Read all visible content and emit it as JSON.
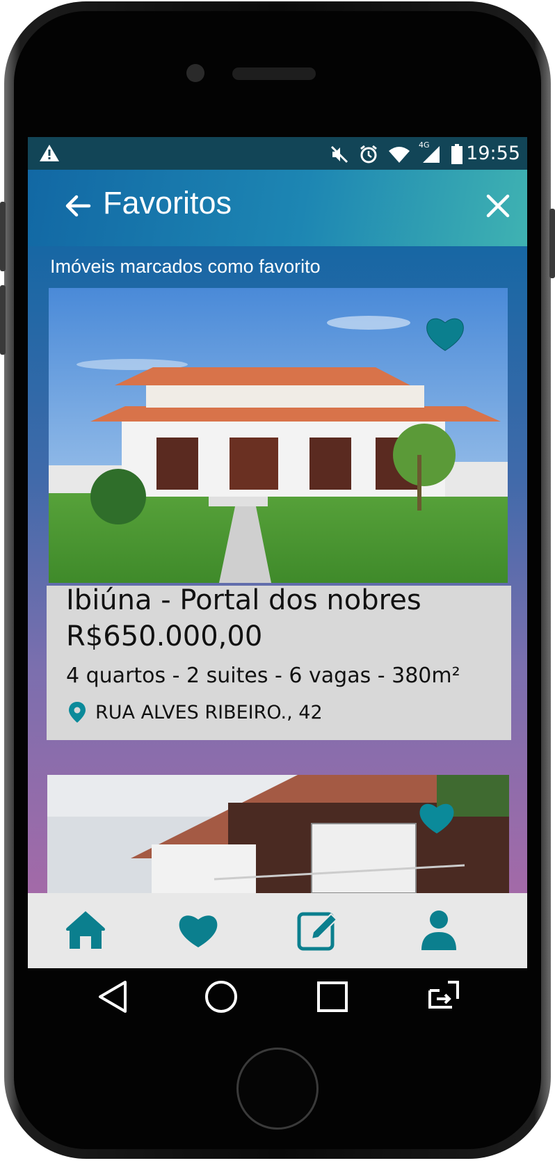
{
  "statusbar": {
    "time": "19:55",
    "network": "4G",
    "icons": [
      "warning-icon",
      "mute-icon",
      "alarm-icon",
      "wifi-icon",
      "signal-icon",
      "battery-icon"
    ]
  },
  "appbar": {
    "title": "Favoritos",
    "back_icon": "arrow-left-icon",
    "close_icon": "close-icon"
  },
  "content": {
    "subtitle": "Imóveis marcados como favorito",
    "listings": [
      {
        "title": "Ibiúna - Portal dos nobres",
        "price": "R$650.000,00",
        "features": "4 quartos - 2 suites - 6 vagas - 380m²",
        "address": "RUA ALVES RIBEIRO., 42",
        "favorite": true
      },
      {
        "favorite": true
      }
    ]
  },
  "bottomnav": {
    "items": [
      "home-icon",
      "heart-icon",
      "edit-icon",
      "user-icon"
    ]
  },
  "sysnav": {
    "items": [
      "back-triangle-icon",
      "home-circle-icon",
      "recents-square-icon",
      "switch-apps-icon"
    ]
  },
  "colors": {
    "statusbar": "#124557",
    "appbar_start": "#1268a4",
    "appbar_end": "#3fb2b2",
    "accent": "#0b8a9a",
    "card_bg": "#d8d8d8",
    "nav_bg": "#e8e8e8"
  }
}
